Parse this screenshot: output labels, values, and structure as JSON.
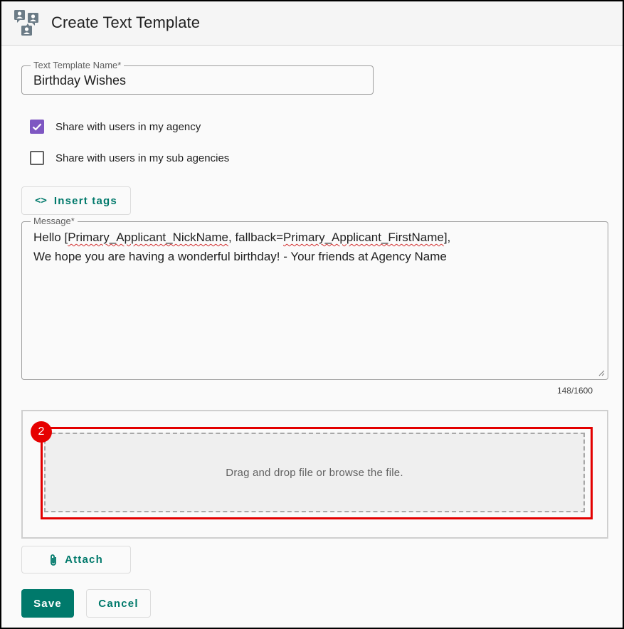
{
  "header": {
    "title": "Create Text Template",
    "icon": "contacts-chat-icon"
  },
  "form": {
    "template_name": {
      "label": "Text Template Name*",
      "value": "Birthday Wishes"
    },
    "share_agency": {
      "label": "Share with users in my agency",
      "checked": true
    },
    "share_sub_agencies": {
      "label": "Share with users in my sub agencies",
      "checked": false
    },
    "insert_tags_label": "Insert tags",
    "message": {
      "label": "Message*",
      "line1_prefix": "Hello [",
      "line1_tag1": "Primary_Applicant_NickName",
      "line1_mid": ", fallback=",
      "line1_tag2": "Primary_Applicant_FirstName",
      "line1_suffix": "],",
      "line2": "We hope you are having a wonderful birthday! - Your friends at Agency Name",
      "counter": "148/1600"
    },
    "dropzone_text": "Drag and drop file or browse the file.",
    "step_badge": "2",
    "attach_label": "Attach",
    "save_label": "Save",
    "cancel_label": "Cancel"
  },
  "colors": {
    "accent": "#00796b",
    "checkbox": "#7e57c2",
    "highlight": "#e30000"
  }
}
